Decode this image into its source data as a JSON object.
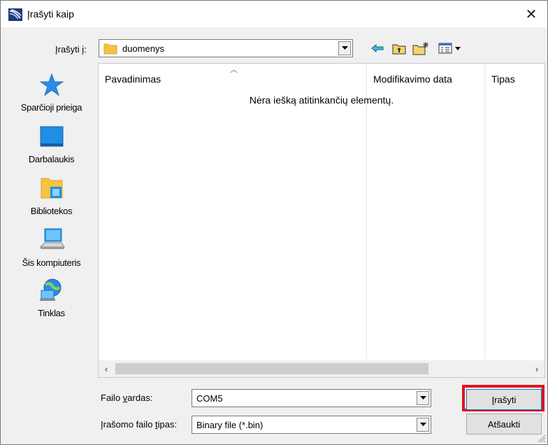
{
  "window": {
    "title": "Įrašyti kaip",
    "close_glyph": "✕"
  },
  "save_in": {
    "label_prefix": "Įrašyti ",
    "label_underlined": "į",
    "label_suffix": ":",
    "value": "duomenys"
  },
  "toolbar_icons": [
    "back-arrow-icon",
    "up-folder-icon",
    "new-folder-icon",
    "view-menu-icon"
  ],
  "places": [
    {
      "label": "Sparčioji prieiga",
      "icon": "star-icon"
    },
    {
      "label": "Darbalaukis",
      "icon": "desktop-icon"
    },
    {
      "label": "Bibliotekos",
      "icon": "libraries-icon"
    },
    {
      "label": "Šis kompiuteris",
      "icon": "computer-icon"
    },
    {
      "label": "Tinklas",
      "icon": "network-icon"
    }
  ],
  "file_list": {
    "columns": [
      "Pavadinimas",
      "Modifikavimo data",
      "Tipas"
    ],
    "empty_message": "Nėra iešką atitinkančių elementų."
  },
  "filename": {
    "label_prefix": "Failo ",
    "label_underlined": "v",
    "label_suffix": "ardas:",
    "value": "COM5"
  },
  "filetype": {
    "label_prefix": "Įrašomo failo ",
    "label_underlined": "t",
    "label_suffix": "ipas:",
    "value": "Binary file (*.bin)"
  },
  "buttons": {
    "save_underlined": "Į",
    "save_rest": "rašyti",
    "cancel": "Atšaukti"
  },
  "colors": {
    "highlight": "#e0141f",
    "accent": "#0078d7",
    "folder": "#f5c242"
  }
}
